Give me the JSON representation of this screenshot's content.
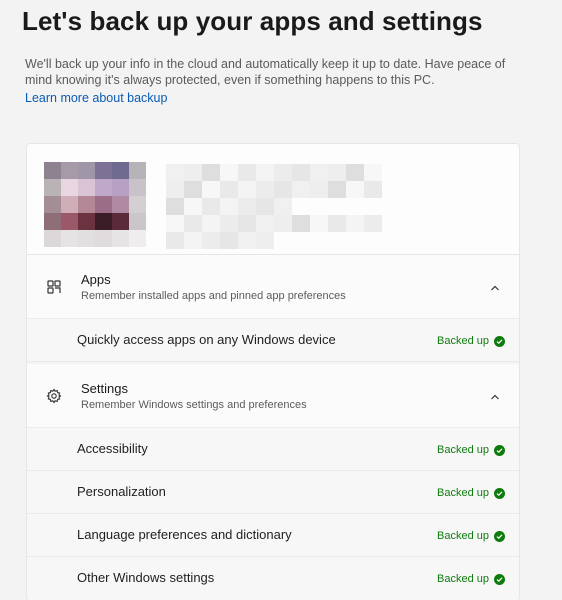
{
  "header": {
    "title": "Let's back up your apps and settings",
    "description": "We'll back up your info in the cloud and automatically keep it up to date. Have peace of mind knowing it's always protected, even if something happens to this PC.",
    "learn_more": "Learn more about backup"
  },
  "account": {
    "avatar_icon": "blurred-avatar",
    "name_icon": "blurred-account-name"
  },
  "sections": [
    {
      "title": "Apps",
      "subtitle": "Remember installed apps and pinned app preferences",
      "icon": "apps-icon",
      "rows": [
        {
          "label": "Quickly access apps on any Windows device",
          "status": "Backed up"
        }
      ]
    },
    {
      "title": "Settings",
      "subtitle": "Remember Windows settings and preferences",
      "icon": "gear-icon",
      "rows": [
        {
          "label": "Accessibility",
          "status": "Backed up"
        },
        {
          "label": "Personalization",
          "status": "Backed up"
        },
        {
          "label": "Language preferences and dictionary",
          "status": "Backed up"
        },
        {
          "label": "Other Windows settings",
          "status": "Backed up"
        }
      ]
    }
  ],
  "colors": {
    "accent_link": "#0a5bb5",
    "status_green": "#0f7b0f"
  }
}
